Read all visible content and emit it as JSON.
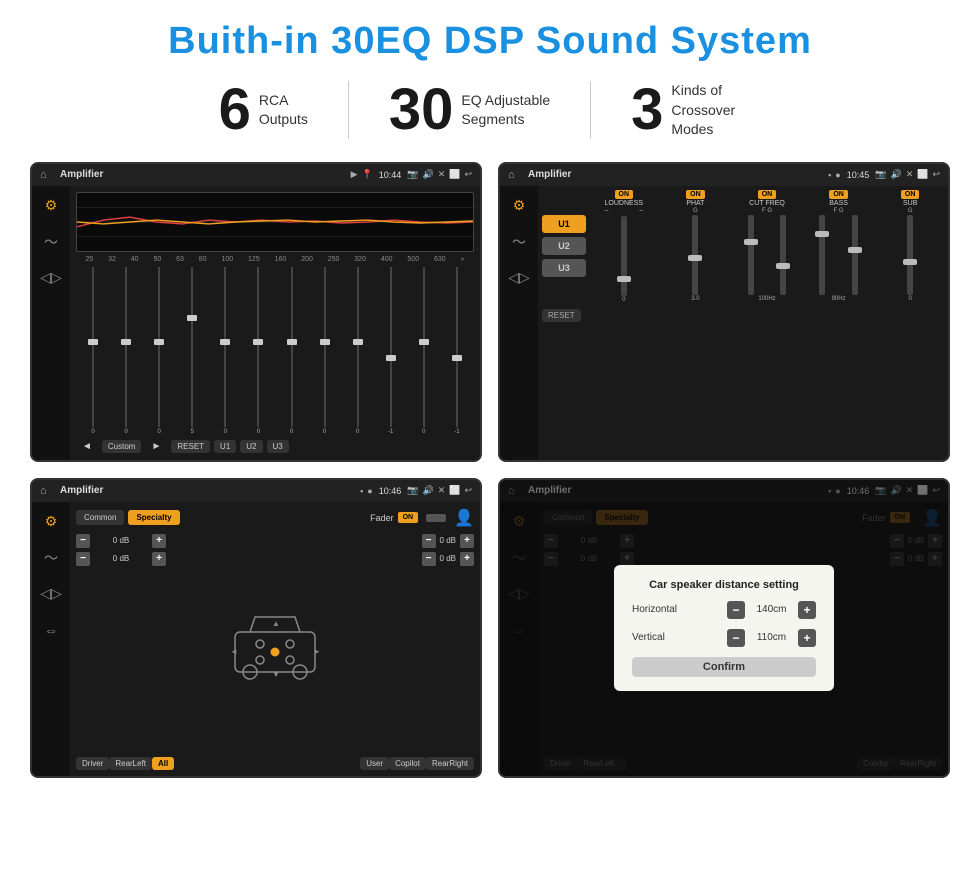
{
  "title": "Buith-in 30EQ DSP Sound System",
  "stats": [
    {
      "number": "6",
      "label": "RCA\nOutputs"
    },
    {
      "number": "30",
      "label": "EQ Adjustable\nSegments"
    },
    {
      "number": "3",
      "label": "Kinds of\nCrossover Modes"
    }
  ],
  "screens": [
    {
      "id": "eq-screen",
      "statusTitle": "Amplifier",
      "time": "10:44",
      "type": "eq"
    },
    {
      "id": "crossover-screen",
      "statusTitle": "Amplifier",
      "time": "10:45",
      "type": "crossover"
    },
    {
      "id": "fader-screen",
      "statusTitle": "Amplifier",
      "time": "10:46",
      "type": "fader"
    },
    {
      "id": "dialog-screen",
      "statusTitle": "Amplifier",
      "time": "10:46",
      "type": "dialog"
    }
  ],
  "eq": {
    "frequencies": [
      "25",
      "32",
      "40",
      "50",
      "63",
      "80",
      "100",
      "125",
      "160",
      "200",
      "250",
      "320",
      "400",
      "500",
      "630"
    ],
    "values": [
      "0",
      "0",
      "0",
      "5",
      "0",
      "0",
      "0",
      "0",
      "0",
      "0",
      "-1",
      "0",
      "-1"
    ],
    "presetLabel": "Custom",
    "buttons": [
      "RESET",
      "U1",
      "U2",
      "U3"
    ]
  },
  "crossover": {
    "uButtons": [
      "U1",
      "U2",
      "U3"
    ],
    "channels": [
      {
        "label": "LOUDNESS",
        "on": true
      },
      {
        "label": "PHAT",
        "on": true
      },
      {
        "label": "CUT FREQ",
        "on": true
      },
      {
        "label": "BASS",
        "on": true
      },
      {
        "label": "SUB",
        "on": true
      }
    ],
    "resetLabel": "RESET"
  },
  "fader": {
    "tabs": [
      "Common",
      "Specialty"
    ],
    "activeTab": "Specialty",
    "faderLabel": "Fader",
    "onLabel": "ON",
    "dbValues": [
      "0 dB",
      "0 dB",
      "0 dB",
      "0 dB"
    ],
    "navButtons": [
      "Driver",
      "RearLeft",
      "All",
      "Copilot",
      "RearRight",
      "User"
    ]
  },
  "dialog": {
    "title": "Car speaker distance setting",
    "horizontalLabel": "Horizontal",
    "horizontalValue": "140cm",
    "verticalLabel": "Vertical",
    "verticalValue": "110cm",
    "confirmLabel": "Confirm"
  }
}
